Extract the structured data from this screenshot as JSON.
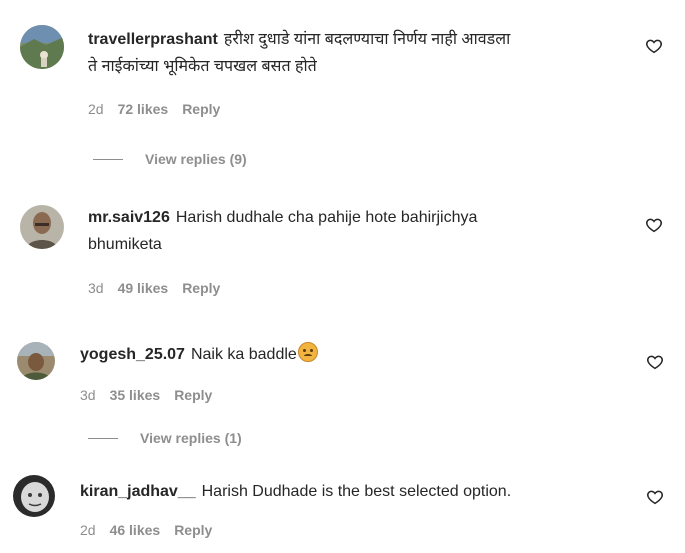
{
  "comments": [
    {
      "username": "travellerprashant",
      "text_line1": "हरीश दुधाडे यांना बदलण्याचा निर्णय नाही आवडला",
      "text_line2": "ते नाईकांच्या भूमिकेत चपखल बसत होते",
      "time": "2d",
      "likes": "72 likes",
      "reply": "Reply",
      "view_replies": "View replies (9)"
    },
    {
      "username": "mr.saiv126",
      "text_line1": "Harish dudhale cha pahije hote bahirjichya",
      "text_line2": "bhumiketa",
      "time": "3d",
      "likes": "49 likes",
      "reply": "Reply"
    },
    {
      "username": "yogesh_25.07",
      "text_line1": "Naik ka baddle",
      "emoji": "sad-face-emoji",
      "time": "3d",
      "likes": "35 likes",
      "reply": "Reply",
      "view_replies": "View replies (1)"
    },
    {
      "username": "kiran_jadhav__",
      "text_line1": "Harish Dudhade is the best selected option.",
      "time": "2d",
      "likes": "46 likes",
      "reply": "Reply"
    }
  ],
  "icons": {
    "like": "heart-outline-icon"
  },
  "colors": {
    "text": "#262626",
    "secondary": "#8e8e8e",
    "background": "#ffffff"
  }
}
